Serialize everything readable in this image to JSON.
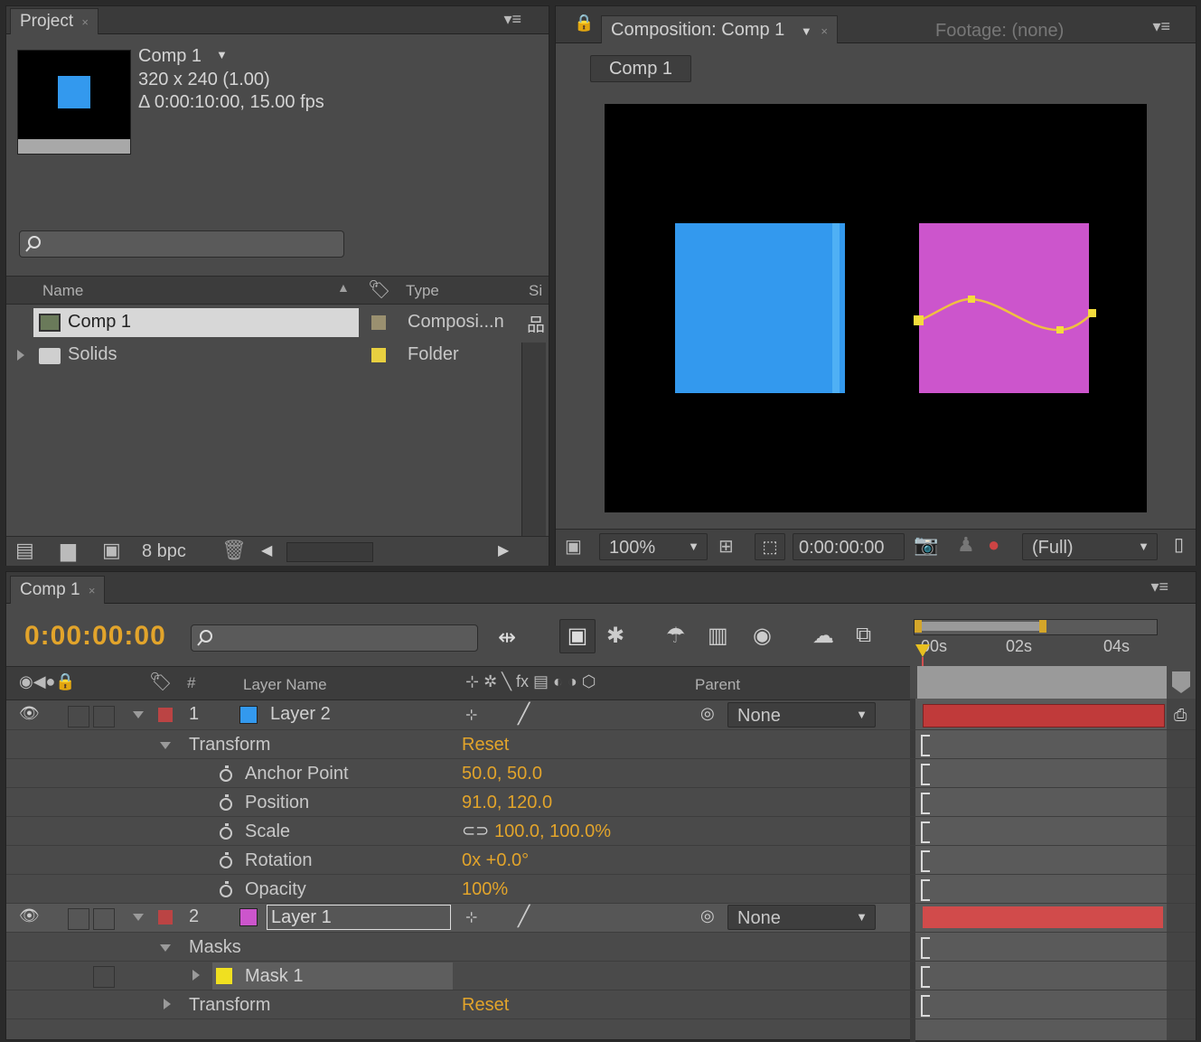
{
  "colors": {
    "accent": "#e2a42b",
    "comp_bg": "#000000",
    "blue_layer": "#3399ee",
    "magenta_layer": "#cc55cc",
    "mask_path": "#f0c040",
    "layer_bar": "#c03a3a",
    "layer_bar_light": "#d14b4b"
  },
  "project": {
    "tab_label": "Project",
    "comp_name": "Comp 1",
    "comp_dimensions": "320 x 240 (1.00)",
    "comp_duration": "Δ 0:00:10:00, 15.00 fps",
    "search_placeholder": "",
    "columns": {
      "name": "Name",
      "type": "Type",
      "size": "Si"
    },
    "items": [
      {
        "name": "Comp 1",
        "type": "Composi...n",
        "icon": "composition-icon"
      },
      {
        "name": "Solids",
        "type": "Folder",
        "icon": "folder-icon"
      }
    ],
    "bpc": "8 bpc"
  },
  "viewer": {
    "tab_label": "Composition: Comp 1",
    "footage_tab": "Footage: (none)",
    "breadcrumb": "Comp 1",
    "zoom": "100%",
    "timecode": "0:00:00:00",
    "resolution": "(Full)"
  },
  "timeline": {
    "tab_label": "Comp 1",
    "current_time": "0:00:00:00",
    "ruler": [
      "00s",
      "02s",
      "04s"
    ],
    "header": {
      "layer_name": "Layer Name",
      "parent": "Parent",
      "num": "#"
    },
    "layers": [
      {
        "index": "1",
        "name": "Layer 2",
        "parent": "None",
        "group": "Transform",
        "group_value": "Reset",
        "props": [
          {
            "name": "Anchor Point",
            "value": "50.0, 50.0"
          },
          {
            "name": "Position",
            "value": "91.0, 120.0"
          },
          {
            "name": "Scale",
            "value": "100.0, 100.0%"
          },
          {
            "name": "Rotation",
            "value": "0x +0.0°"
          },
          {
            "name": "Opacity",
            "value": "100%"
          }
        ]
      },
      {
        "index": "2",
        "name": "Layer 1",
        "parent": "None",
        "masks_label": "Masks",
        "mask_name": "Mask 1",
        "transform_label": "Transform",
        "transform_value": "Reset"
      }
    ]
  }
}
